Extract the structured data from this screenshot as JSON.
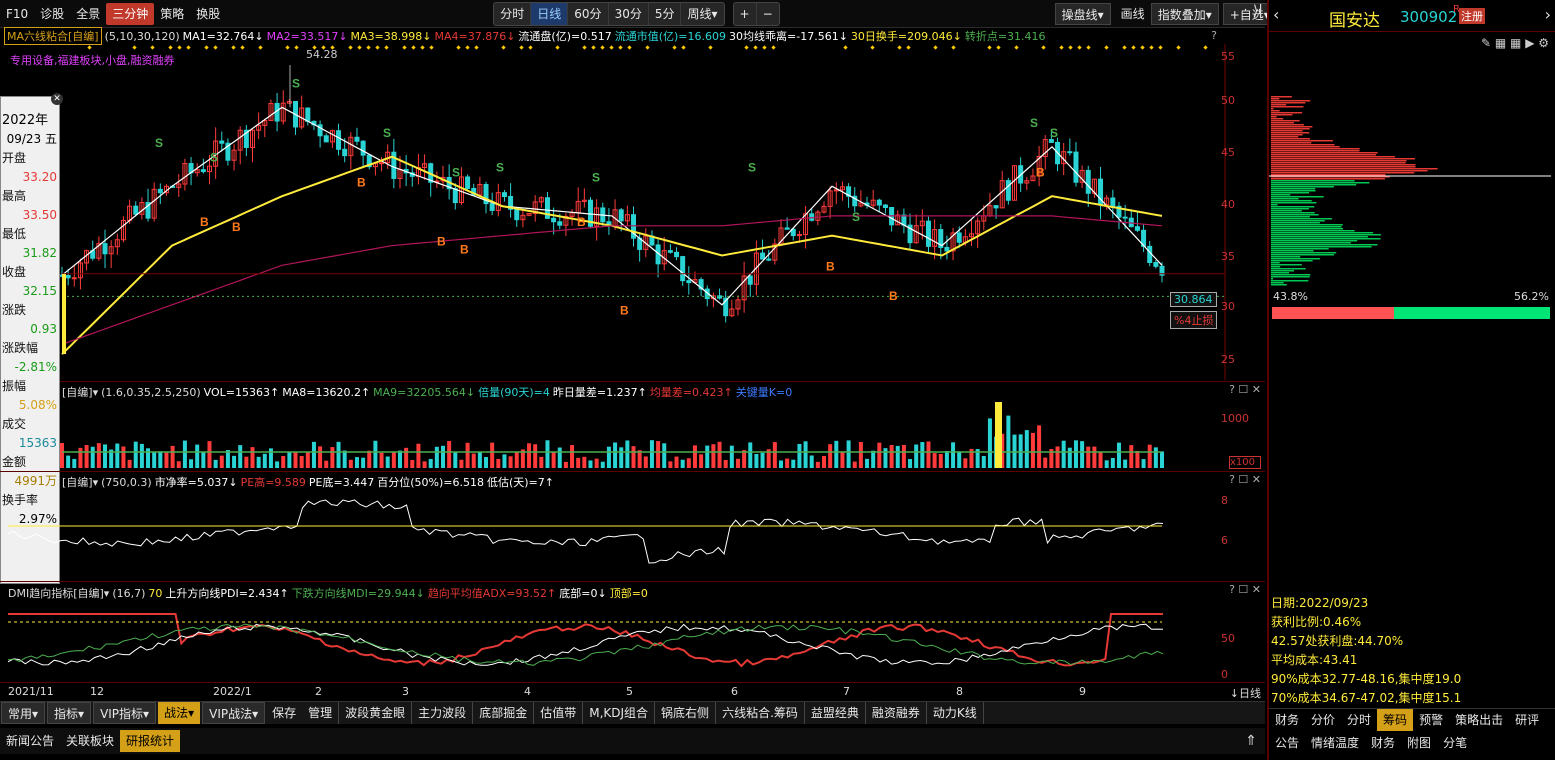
{
  "top_nav": {
    "left": [
      "F10",
      "诊股",
      "全景",
      "三分钟",
      "策略",
      "换股"
    ],
    "active_left": "三分钟",
    "periods": [
      "分时",
      "日线",
      "60分",
      "30分",
      "5分",
      "周线▾"
    ],
    "active_period": "日线",
    "zoom": [
      "+",
      "−"
    ],
    "right": [
      "操盘线▾",
      "画线",
      "指数叠加▾",
      "+自选▾"
    ]
  },
  "main": {
    "indicator_name": "MA六线粘合[自编]",
    "params": "(5,10,30,120)",
    "ma1": "MA1=32.764↓",
    "ma2": "MA2=33.517↓",
    "ma3": "MA3=38.998↓",
    "ma4": "MA4=37.876↓",
    "float_shares": "流通盘(亿)=0.517",
    "float_value": "流通市值(亿)=16.609",
    "dev30": "30均线乖离=-17.561↓",
    "turnover30": "30日换手=209.046↓",
    "turn_point": "转折点=31.416",
    "sector": "专用设备,福建板块,小盘,融资融券",
    "peak": "54.28",
    "price_tag": "30.864",
    "stop_tag": "%4止损",
    "y_ticks": [
      "55",
      "50",
      "45",
      "40",
      "35",
      "30",
      "25"
    ]
  },
  "info_box": {
    "year": "2022年",
    "date": "09/23 五",
    "open_label": "开盘",
    "open": "33.20",
    "high_label": "最高",
    "high": "33.50",
    "low_label": "最低",
    "low": "31.82",
    "close_label": "收盘",
    "close": "32.15",
    "chg_label": "涨跌",
    "chg": "0.93",
    "pct_label": "涨跌幅",
    "pct": "-2.81%",
    "amp_label": "振幅",
    "amp": "5.08%",
    "vol_label": "成交",
    "vol": "15363",
    "amt_label": "金额",
    "amt": "4991万",
    "turn_label": "换手率",
    "turn": "2.97%"
  },
  "vol_panel": {
    "name": "[自编]▾",
    "params": "(1.6,0.35,2.5,250)",
    "vol": "VOL=15363↑",
    "ma8": "MA8=13620.2↑",
    "ma9": "MA9=32205.564↓",
    "times": "倍量(90天)=4",
    "yday": "昨日量差=1.237↑",
    "avg": "均量差=0.423↑",
    "key": "关键量K=0",
    "y_ticks": [
      "1000",
      "x100"
    ]
  },
  "pe_panel": {
    "name": "[自编]▾",
    "params": "(750,0.3)",
    "pb": "市净率=5.037↓",
    "pe_high": "PE高=9.589",
    "pe_low": "PE底=3.447",
    "pct": "百分位(50%)=6.518",
    "low_days": "低估(天)=7↑",
    "y_ticks": [
      "8",
      "6"
    ]
  },
  "dmi_panel": {
    "name": "DMI趋向指标[自编]▾",
    "params": "(16,7)",
    "v70": "70",
    "pdi": "上升方向线PDI=2.434↑",
    "mdi": "下跌方向线MDI=29.944↓",
    "adx": "趋向平均值ADX=93.52↑",
    "bottom": "底部=0↓",
    "top": "顶部=0",
    "y_ticks": [
      "50",
      "0"
    ]
  },
  "x_axis": [
    "2021/11",
    "12",
    "2022/1",
    "2",
    "3",
    "4",
    "5",
    "6",
    "7",
    "8",
    "9"
  ],
  "x_axis_right": "↓日线",
  "bottom_tabs": [
    "常用▾",
    "指标▾",
    "VIP指标▾",
    "战法▾",
    "VIP战法▾",
    "保存",
    "管理",
    "波段黄金眼",
    "主力波段",
    "底部掘金",
    "估值带",
    "M,KDJ组合",
    "锅底右侧",
    "六线粘合.筹码",
    "益盟经典",
    "融资融券",
    "动力K线"
  ],
  "bottom_active": "战法▾",
  "bottom_tabs2": [
    "新闻公告",
    "关联板块",
    "研报统计"
  ],
  "bottom_active2": "研报统计",
  "right_panel": {
    "name": "国安达",
    "code": "300902",
    "mark": "R",
    "register": "注册",
    "pct_left": "43.8%",
    "pct_right": "56.2%",
    "date": "日期:2022/09/23",
    "profit_ratio": "获利比例:0.46%",
    "profit_at": "42.57处获利盘:44.70%",
    "avg_cost": "平均成本:43.41",
    "cost90": "90%成本32.77-48.16,集中度19.0",
    "cost70": "70%成本34.67-47.02,集中度15.1",
    "tabs1": [
      "财务",
      "分价",
      "分时",
      "筹码",
      "预警",
      "策略出击",
      "研评"
    ],
    "tabs1_active": "筹码",
    "tabs2": [
      "公告",
      "情绪温度",
      "财务",
      "附图",
      "分笔"
    ]
  },
  "chart_data": {
    "type": "line",
    "title": "",
    "x": [
      "2021/11",
      "12",
      "2022/1",
      "2",
      "3",
      "4",
      "5",
      "6",
      "7",
      "8",
      "9"
    ],
    "series": [
      {
        "name": "MA1",
        "values": [
          33,
          42,
          50,
          44,
          40,
          39,
          30,
          42,
          36,
          46,
          34
        ]
      },
      {
        "name": "MA3",
        "values": [
          25,
          36,
          41,
          45,
          40,
          38,
          35,
          37,
          35,
          41,
          39
        ]
      },
      {
        "name": "MA4",
        "values": [
          26,
          30,
          34,
          36,
          37,
          38,
          38,
          39,
          39,
          39,
          38
        ]
      }
    ],
    "ylim": [
      23,
      56
    ],
    "price_line": 30.864,
    "current_close": 32.15
  }
}
